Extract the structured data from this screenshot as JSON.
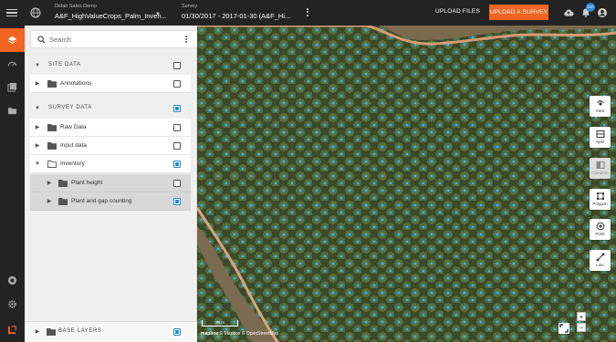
{
  "header": {
    "org_label": "Delair Sales Demo",
    "project_name": "A&F_HighValueCrops_Palm_Inven...",
    "survey_label": "Survey",
    "survey_value": "01/30/2017 - 2017-01-30 (A&F_Hi...",
    "upload_files": "UPLOAD FILES",
    "upload_survey": "UPLOAD A SURVEY",
    "notification_count": "210",
    "accent_color": "#f26522"
  },
  "rail": {
    "icons": [
      "layers-icon",
      "dashboard-icon",
      "gallery-icon",
      "folder-icon",
      "support-icon",
      "settings-icon",
      "delair-logo-icon"
    ]
  },
  "sidebar": {
    "search_placeholder": "Search",
    "site_data": {
      "label": "SITE DATA",
      "items": [
        {
          "label": "Annotations",
          "checked": false
        }
      ]
    },
    "survey_data": {
      "label": "SURVEY DATA",
      "items": [
        {
          "label": "Raw Data",
          "checked": false
        },
        {
          "label": "Input data",
          "checked": false
        },
        {
          "label": "Inventory",
          "checked": true
        },
        {
          "label": "Plant height",
          "checked": false
        },
        {
          "label": "Plant and gap counting",
          "checked": true
        }
      ]
    },
    "base_layers": {
      "label": "BASE LAYERS",
      "checked": true
    }
  },
  "map": {
    "tools": [
      {
        "label": "View",
        "icon": "view-icon"
      },
      {
        "label": "Split",
        "icon": "split-icon"
      },
      {
        "label": "Compare",
        "icon": "compare-icon",
        "disabled": true
      },
      {
        "label": "Polygon",
        "icon": "polygon-icon"
      },
      {
        "label": "Point",
        "icon": "point-icon"
      },
      {
        "label": "Line",
        "icon": "line-icon"
      }
    ],
    "zoom_in": "+",
    "zoom_out": "−",
    "scale": "20 m",
    "attribution_brand": "mapbox",
    "attribution": "© Mapbox © OpenStreetMap"
  }
}
